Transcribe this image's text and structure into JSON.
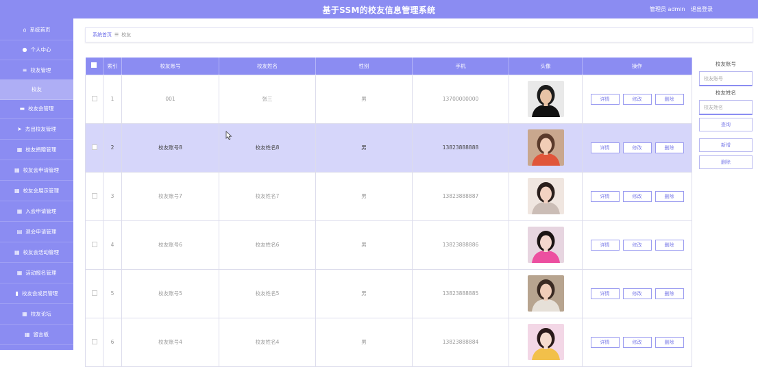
{
  "header": {
    "title": "基于SSM的校友信息管理系统",
    "user": "管理员 admin",
    "logout": "退出登录"
  },
  "sidebar": {
    "items": [
      {
        "label": "系统首页",
        "icon": "home-icon"
      },
      {
        "label": "个人中心",
        "icon": "user-icon"
      },
      {
        "label": "校友管理",
        "icon": "list-icon"
      },
      {
        "label": "校友",
        "icon": ""
      },
      {
        "label": "校友会管理",
        "icon": "chat-icon"
      },
      {
        "label": "杰出校友管理",
        "icon": "send-icon"
      },
      {
        "label": "校友捐赠管理",
        "icon": "grid-icon"
      },
      {
        "label": "校友会申请管理",
        "icon": "grid-icon"
      },
      {
        "label": "校友会展示管理",
        "icon": "grid-icon"
      },
      {
        "label": "入会申请管理",
        "icon": "grid-icon"
      },
      {
        "label": "退会申请管理",
        "icon": "table-icon"
      },
      {
        "label": "校友会活动管理",
        "icon": "grid-icon"
      },
      {
        "label": "活动报名管理",
        "icon": "grid-icon"
      },
      {
        "label": "校友会成员管理",
        "icon": "clipboard-icon"
      },
      {
        "label": "校友论坛",
        "icon": "grid-icon"
      },
      {
        "label": "留言板",
        "icon": "grid-icon"
      }
    ]
  },
  "breadcrumb": {
    "home": "系统首页",
    "separator": "☰",
    "current": "校友"
  },
  "table": {
    "headers": [
      "索引",
      "校友账号",
      "校友姓名",
      "性别",
      "手机",
      "头像",
      "操作"
    ],
    "rows": [
      {
        "index": "1",
        "account": "001",
        "name": "张三",
        "gender": "男",
        "phone": "13700000000"
      },
      {
        "index": "2",
        "account": "校友账号8",
        "name": "校友姓名8",
        "gender": "男",
        "phone": "13823888888"
      },
      {
        "index": "3",
        "account": "校友账号7",
        "name": "校友姓名7",
        "gender": "男",
        "phone": "13823888887"
      },
      {
        "index": "4",
        "account": "校友账号6",
        "name": "校友姓名6",
        "gender": "男",
        "phone": "13823888886"
      },
      {
        "index": "5",
        "account": "校友账号5",
        "name": "校友姓名5",
        "gender": "男",
        "phone": "13823888885"
      },
      {
        "index": "6",
        "account": "校友账号4",
        "name": "校友姓名4",
        "gender": "男",
        "phone": "13823888884"
      }
    ],
    "actions": {
      "detail": "详情",
      "edit": "修改",
      "delete": "删除"
    }
  },
  "search": {
    "account_label": "校友账号",
    "account_placeholder": "校友账号",
    "name_label": "校友姓名",
    "name_placeholder": "校友姓名",
    "search_button": "查询",
    "add_button": "新增",
    "delete_button": "删除"
  },
  "colors": {
    "primary": "#8b8cf2",
    "highlight_row": "#d6d6fa",
    "sub_item": "#aeaef5"
  }
}
